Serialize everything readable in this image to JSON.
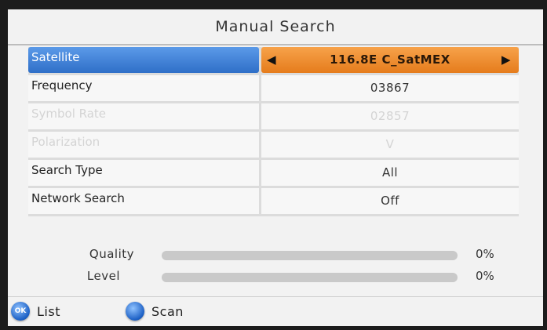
{
  "title": "Manual Search",
  "settings": [
    {
      "label": "Satellite",
      "value": "116.8E C_SatMEX",
      "state": "selected"
    },
    {
      "label": "Frequency",
      "value": "03867",
      "state": "normal"
    },
    {
      "label": "Symbol Rate",
      "value": "02857",
      "state": "disabled"
    },
    {
      "label": "Polarization",
      "value": "V",
      "state": "disabled"
    },
    {
      "label": "Search Type",
      "value": "All",
      "state": "normal"
    },
    {
      "label": "Network Search",
      "value": "Off",
      "state": "normal"
    }
  ],
  "selector": {
    "left_icon": "triangle-left-icon",
    "right_icon": "triangle-right-icon"
  },
  "meters": {
    "quality": {
      "label": "Quality",
      "value_text": "0%",
      "fraction": 0
    },
    "level": {
      "label": "Level",
      "value_text": "0%",
      "fraction": 0
    }
  },
  "footer": {
    "list": {
      "badge": "OK",
      "label": "List",
      "icon": "ok-button-icon"
    },
    "scan": {
      "badge": "",
      "label": "Scan",
      "icon": "blue-button-icon"
    }
  },
  "colors": {
    "selected_label": "#2f6fc8",
    "selected_value": "#e57c1c",
    "meter_fill": "#6aa0e0"
  }
}
